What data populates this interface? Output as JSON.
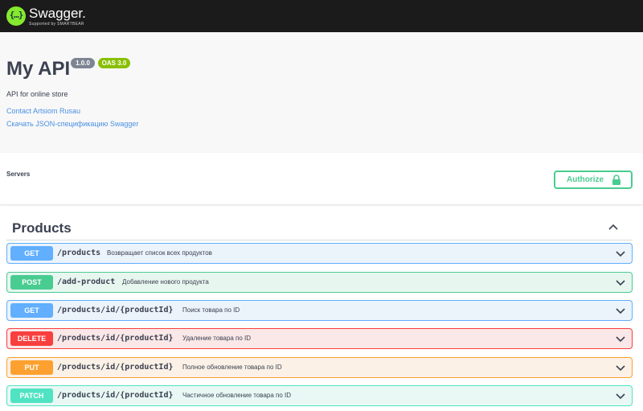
{
  "topbar": {
    "logo_icon": "swagger-logo-icon",
    "logo_glyph": "{…}",
    "brand": "Swagger.",
    "brand_sub": "Supported by SMARTBEAR"
  },
  "info": {
    "title": "My API",
    "version": "1.0.0",
    "oas": "OAS 3.0",
    "description": "API for online store",
    "contact_link": "Contact Artsiom Rusau",
    "spec_link": "Скачать JSON-спецификацию Swagger"
  },
  "scheme": {
    "servers_label": "Servers",
    "authorize_label": "Authorize",
    "authorize_icon": "lock-icon"
  },
  "tag": {
    "name": "Products",
    "collapse_icon": "chevron-up-icon"
  },
  "operations": [
    {
      "method": "GET",
      "path": "/products",
      "summary": "Возвращает список всех продуктов",
      "color": "#61affe"
    },
    {
      "method": "POST",
      "path": "/add-product",
      "summary": "Добавление нового продукта",
      "color": "#49cc90"
    },
    {
      "method": "GET",
      "path": "/products/id/{productId}",
      "summary": "Поиск товара по ID",
      "color": "#61affe"
    },
    {
      "method": "DELETE",
      "path": "/products/id/{productId}",
      "summary": "Удаление товара по ID",
      "color": "#f93e3e"
    },
    {
      "method": "PUT",
      "path": "/products/id/{productId}",
      "summary": "Полное обновление товара по ID",
      "color": "#fca130"
    },
    {
      "method": "PATCH",
      "path": "/products/id/{productId}",
      "summary": "Частичное обновление товара по ID",
      "color": "#50e3c2"
    }
  ],
  "colors": {
    "topbar": "#1b1b1b",
    "brand_green": "#85ea2d",
    "link": "#4990e2",
    "authorize": "#49cc90"
  }
}
